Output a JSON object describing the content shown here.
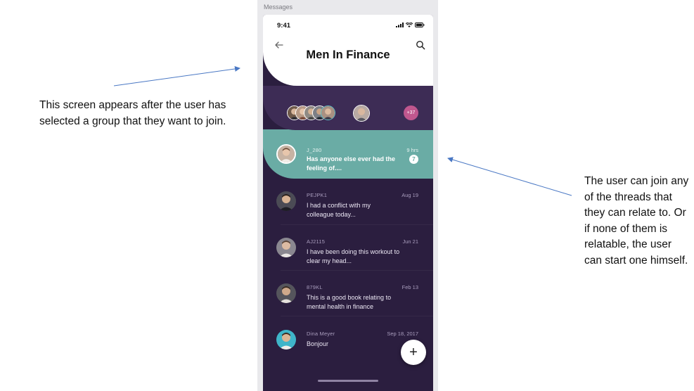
{
  "annotations": {
    "left_note": "This screen appears after the user has selected a group that they want to join.",
    "right_note": "The user can join any of the threads that they can relate to. Or if none of them is relatable, the user can start one himself."
  },
  "artboard_label": "Messages",
  "status_bar": {
    "time": "9:41"
  },
  "header": {
    "title": "Men In Finance"
  },
  "members": {
    "extra_count": "+37"
  },
  "threads": [
    {
      "user": "J_280",
      "date": "9 hrs",
      "message": "Has anyone else ever had the feeling of....",
      "unread": "7",
      "highlighted": true
    },
    {
      "user": "PEJPK1",
      "date": "Aug 19",
      "message": "I had a conflict with my colleague today..."
    },
    {
      "user": "AJ2115",
      "date": "Jun 21",
      "message": "I have been doing this workout to clear my head..."
    },
    {
      "user": "879KL",
      "date": "Feb 13",
      "message": "This is a good book relating to mental health in finance"
    },
    {
      "user": "Dina Meyer",
      "date": "Sep 18, 2017",
      "message": "Bonjour"
    }
  ],
  "fab": {
    "label": "+"
  },
  "colors": {
    "header_bg": "#ffffff",
    "list_bg": "#2b1e3f",
    "avatars_bg": "#3d2c55",
    "highlight": "#6aaca5",
    "badge": "#c0578e"
  }
}
